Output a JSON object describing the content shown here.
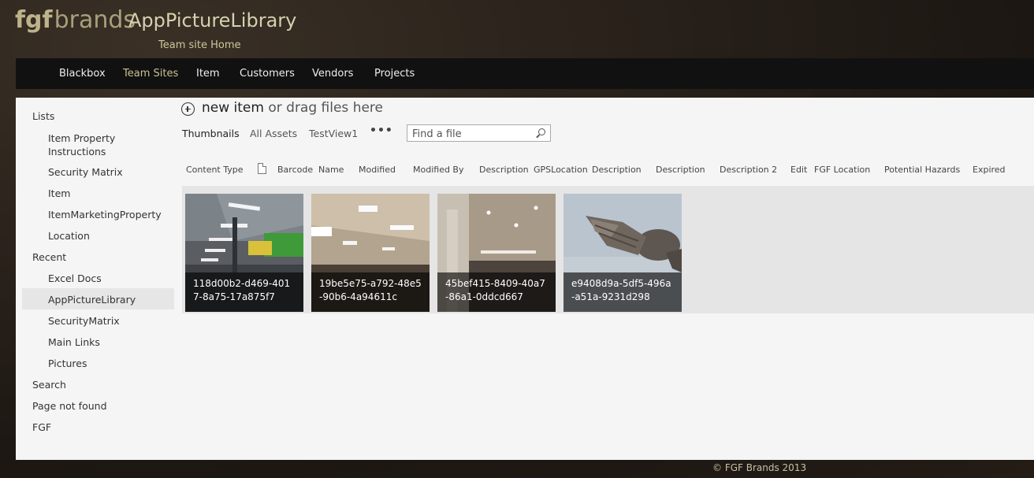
{
  "header": {
    "logo_fgf": "fgf",
    "logo_brands": "brands",
    "site_title": "AppPictureLibrary",
    "subtitle": "Team site Home"
  },
  "topnav": {
    "items": [
      {
        "label": "Blackbox",
        "active": false
      },
      {
        "label": "Team Sites",
        "active": true
      },
      {
        "label": "Item",
        "active": false
      },
      {
        "label": "Customers",
        "active": false
      },
      {
        "label": "Vendors",
        "active": false
      },
      {
        "label": "Projects",
        "active": false
      }
    ]
  },
  "quicklaunch": {
    "items": [
      {
        "label": "Lists",
        "level": "top"
      },
      {
        "label": "Item Property Instructions",
        "level": "sub"
      },
      {
        "label": "Security Matrix",
        "level": "sub"
      },
      {
        "label": "Item",
        "level": "sub"
      },
      {
        "label": "ItemMarketingProperty",
        "level": "sub"
      },
      {
        "label": "Location",
        "level": "sub"
      },
      {
        "label": "Recent",
        "level": "top"
      },
      {
        "label": "Excel Docs",
        "level": "sub"
      },
      {
        "label": "AppPictureLibrary",
        "level": "sub",
        "selected": true
      },
      {
        "label": "SecurityMatrix",
        "level": "sub"
      },
      {
        "label": "Main Links",
        "level": "sub"
      },
      {
        "label": "Pictures",
        "level": "sub"
      },
      {
        "label": "Search",
        "level": "top"
      },
      {
        "label": "Page not found",
        "level": "top"
      },
      {
        "label": "FGF",
        "level": "top"
      }
    ]
  },
  "toolbar": {
    "new_item_link": "new item",
    "new_item_rest": " or drag files here",
    "plus_icon": "circle-plus-icon"
  },
  "views": {
    "items": [
      "Thumbnails",
      "All Assets",
      "TestView1"
    ],
    "selected": "Thumbnails",
    "more": "•••"
  },
  "search": {
    "placeholder": "Find a file",
    "icon": "search-icon"
  },
  "columns": [
    "Content Type",
    "Barcode",
    "Name",
    "Modified",
    "Modified By",
    "Description",
    "GPSLocation",
    "Description",
    "Description",
    "Description 2",
    "Edit",
    "FGF Location",
    "Potential Hazards",
    "Expired"
  ],
  "tiles": [
    {
      "caption": "118d00b2-d469-4017-8a75-17a875f7"
    },
    {
      "caption": "19be5e75-a792-48e5-90b6-4a94611c"
    },
    {
      "caption": "45bef415-8409-40a7-86a1-0ddcd667"
    },
    {
      "caption": "e9408d9a-5df5-496a-a51a-9231d298"
    }
  ],
  "footer": {
    "copyright": "© FGF Brands 2013"
  },
  "colors": {
    "topnav_bg": "#111111",
    "active_nav": "#c9c090",
    "content_bg": "#f5f5f5"
  }
}
